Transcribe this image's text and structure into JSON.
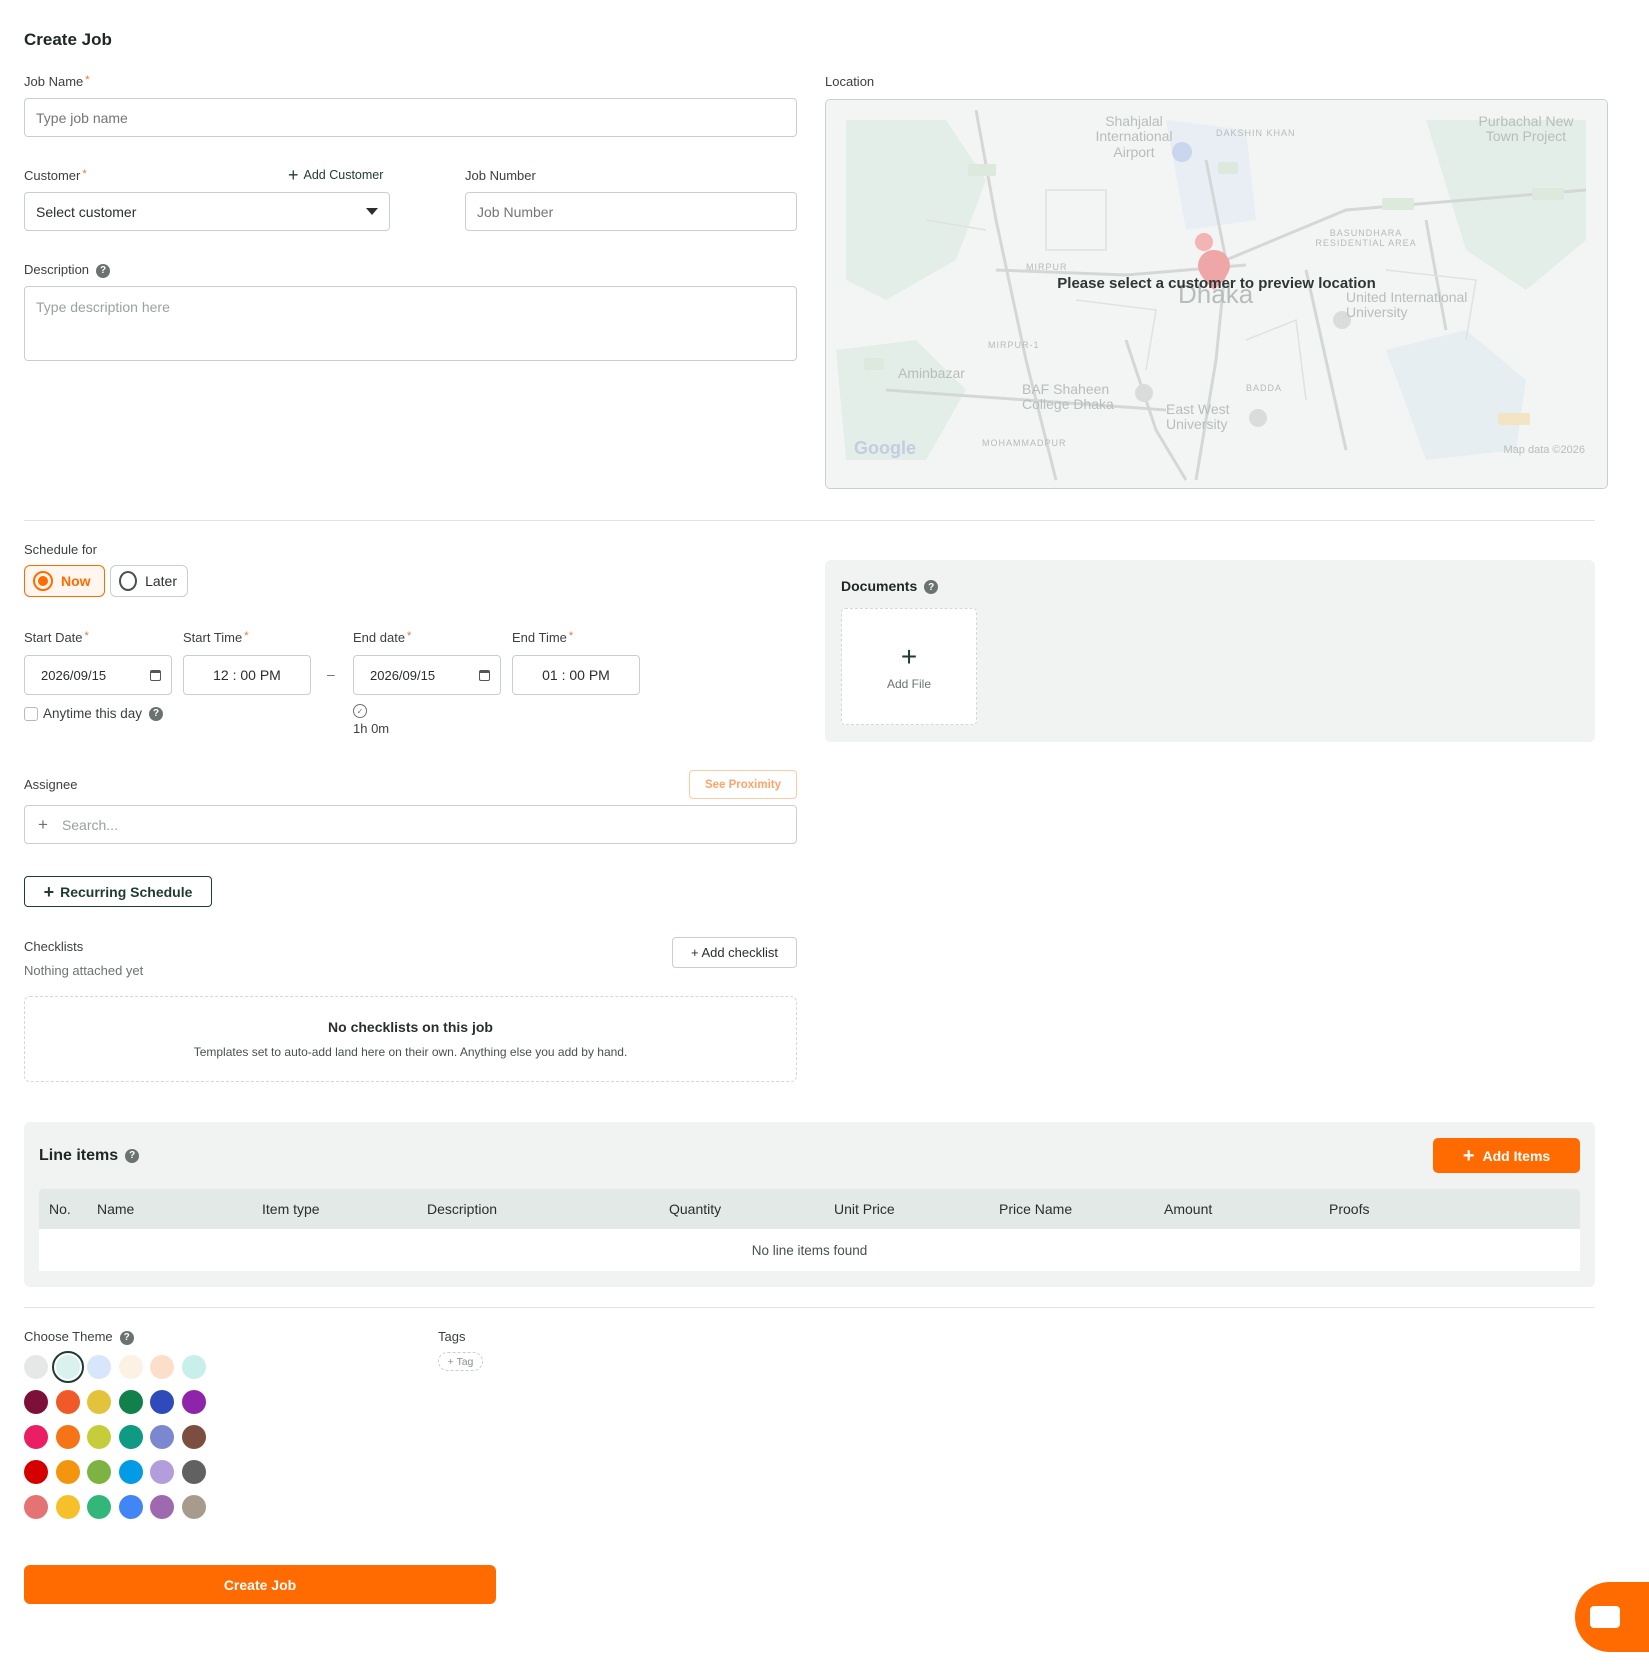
{
  "page_title": "Create Job",
  "job_name": {
    "label": "Job Name",
    "placeholder": "Type job name"
  },
  "customer": {
    "label": "Customer",
    "value": "Select customer",
    "add_label": "Add Customer"
  },
  "job_number": {
    "label": "Job Number",
    "placeholder": "Job Number"
  },
  "description": {
    "label": "Description",
    "placeholder": "Type description here"
  },
  "location": {
    "label": "Location",
    "message": "Please select a customer to preview location",
    "map_labels": [
      "Shahjalal International Airport",
      "DAKSHIN KHAN",
      "Purbachal New Town Project",
      "BASUNDHARA RESIDENTIAL AREA",
      "MIRPUR",
      "Dhaka",
      "United International University",
      "MIRPUR-1",
      "Aminbazar",
      "BAF Shaheen College Dhaka",
      "East West University",
      "BADDA",
      "MOHAMMADPUR"
    ],
    "map_credit": "Map data ©2026",
    "map_logo": "Google"
  },
  "schedule": {
    "label": "Schedule for",
    "options": [
      "Now",
      "Later"
    ],
    "selected": "Now",
    "start_date_label": "Start Date",
    "start_date": "2026/09/15",
    "start_time_label": "Start Time",
    "start_time": "12 : 00 PM",
    "separator": "–",
    "end_date_label": "End date",
    "end_date": "2026/09/15",
    "end_time_label": "End Time",
    "end_time": "01 : 00 PM",
    "anytime_label": "Anytime this day",
    "duration": "1h 0m"
  },
  "documents": {
    "title": "Documents",
    "add_file": "Add File"
  },
  "assignee": {
    "label": "Assignee",
    "proximity": "See Proximity",
    "placeholder": "Search..."
  },
  "recurring": {
    "label": "Recurring Schedule"
  },
  "checklists": {
    "label": "Checklists",
    "sub": "Nothing attached yet",
    "add": "+ Add checklist",
    "empty_title": "No checklists on this job",
    "empty_text": "Templates set to auto-add land here on their own. Anything else you add by hand."
  },
  "line_items": {
    "title": "Line items",
    "add": "Add Items",
    "columns": [
      "No.",
      "Name",
      "Item type",
      "Description",
      "Quantity",
      "Unit Price",
      "Price Name",
      "Amount",
      "Proofs"
    ],
    "empty": "No line items found"
  },
  "theme": {
    "label": "Choose Theme",
    "selected_index": 1,
    "colors": [
      "#e6e8e7",
      "#d9f2ee",
      "#d8e6fb",
      "#fbf2e4",
      "#fbdfcb",
      "#c9efea",
      "#7d1038",
      "#f05a28",
      "#e2c33b",
      "#11804a",
      "#2f4ab9",
      "#8e24aa",
      "#e91e63",
      "#f47417",
      "#c5ce3a",
      "#0f9a84",
      "#7b87cf",
      "#7b4e3f",
      "#d50000",
      "#f49510",
      "#7cb342",
      "#039be5",
      "#b39ddb",
      "#616161",
      "#e57373",
      "#f6c02b",
      "#33b679",
      "#4285f4",
      "#9e69af",
      "#a79b8e"
    ]
  },
  "tags": {
    "label": "Tags",
    "add": "+ Tag"
  },
  "submit": {
    "label": "Create Job"
  },
  "colors": {
    "accent": "#ff6b00",
    "primary_dark": "#1f3b33"
  }
}
